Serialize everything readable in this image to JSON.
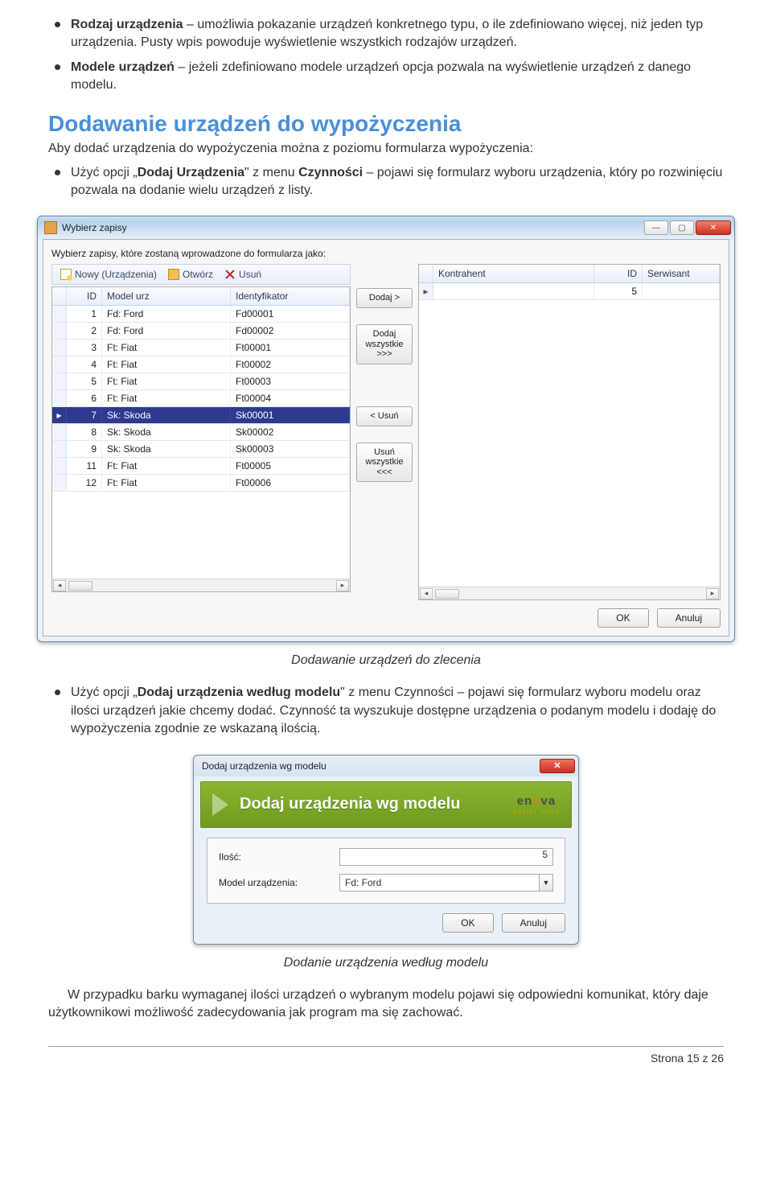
{
  "bullets_top": [
    {
      "bold": "Rodzaj urządzenia",
      "rest": " – umożliwia pokazanie urządzeń konkretnego typu, o ile zdefiniowano więcej, niż jeden typ urządzenia. Pusty wpis powoduje wyświetlenie wszystkich rodzajów urządzeń."
    },
    {
      "bold": "Modele urządzeń",
      "rest": " – jeżeli zdefiniowano modele urządzeń opcja pozwala na wyświetlenie urządzeń z danego modelu."
    }
  ],
  "section_title": "Dodawanie urządzeń do wypożyczenia",
  "section_intro": "Aby dodać urządzenia do wypożyczenia można z poziomu formularza wypożyczenia:",
  "bullet_mid": {
    "pre": "Użyć opcji „",
    "b1": "Dodaj Urządzenia",
    "mid": "\" z menu ",
    "b2": "Czynności",
    "rest": " – pojawi się formularz wyboru urządzenia, który po rozwinięciu pozwala na dodanie wielu urządzeń z listy."
  },
  "dialog1": {
    "title": "Wybierz zapisy",
    "instruction": "Wybierz zapisy, które zostaną wprowadzone do formularza jako:",
    "toolbar": {
      "new": "Nowy (Urządzenia)",
      "open": "Otwórz",
      "delete": "Usuń"
    },
    "left_headers": {
      "id": "ID",
      "model": "Model urz",
      "ident": "Identyfikator"
    },
    "left_rows": [
      {
        "id": "1",
        "model": "Fd: Ford",
        "ident": "Fd00001",
        "sel": false
      },
      {
        "id": "2",
        "model": "Fd: Ford",
        "ident": "Fd00002",
        "sel": false
      },
      {
        "id": "3",
        "model": "Ft: Fiat",
        "ident": "Ft00001",
        "sel": false
      },
      {
        "id": "4",
        "model": "Ft: Fiat",
        "ident": "Ft00002",
        "sel": false
      },
      {
        "id": "5",
        "model": "Ft: Fiat",
        "ident": "Ft00003",
        "sel": false
      },
      {
        "id": "6",
        "model": "Ft: Fiat",
        "ident": "Ft00004",
        "sel": false
      },
      {
        "id": "7",
        "model": "Sk: Skoda",
        "ident": "Sk00001",
        "sel": true
      },
      {
        "id": "8",
        "model": "Sk: Skoda",
        "ident": "Sk00002",
        "sel": false
      },
      {
        "id": "9",
        "model": "Sk: Skoda",
        "ident": "Sk00003",
        "sel": false
      },
      {
        "id": "11",
        "model": "Ft: Fiat",
        "ident": "Ft00005",
        "sel": false
      },
      {
        "id": "12",
        "model": "Ft: Fiat",
        "ident": "Ft00006",
        "sel": false
      }
    ],
    "mid_buttons": {
      "add": "Dodaj >",
      "add_all": "Dodaj wszystkie >>>",
      "remove": "< Usuń",
      "remove_all": "Usuń wszystkie <<<"
    },
    "right_headers": {
      "kontr": "Kontrahent",
      "id": "ID",
      "serw": "Serwisant"
    },
    "right_rows": [
      {
        "kontr": "",
        "id": "5",
        "serw": ""
      }
    ],
    "ok": "OK",
    "cancel": "Anuluj"
  },
  "caption1": "Dodawanie urządzeń do zlecenia",
  "bullet_mid2": {
    "pre": "Użyć opcji „",
    "b1": "Dodaj urządzenia według modelu",
    "rest": "\" z menu Czynności – pojawi się formularz wyboru modelu oraz ilości urządzeń jakie chcemy dodać. Czynność ta wyszukuje dostępne urządzenia o podanym modelu i dodaję do wypożyczenia zgodnie ze wskazaną ilością."
  },
  "dialog2": {
    "title": "Dodaj urządzenia wg modelu",
    "banner": "Dodaj urządzenia wg modelu",
    "brand": "enova",
    "brand_sub": "pakiet złoty",
    "label_qty": "Ilość:",
    "value_qty": "5",
    "label_model": "Model urządzenia:",
    "value_model": "Fd: Ford",
    "ok": "OK",
    "cancel": "Anuluj"
  },
  "caption2": "Dodanie urządzenia według modelu",
  "closing_para": "W przypadku barku wymaganej ilości urządzeń o wybranym modelu pojawi się odpowiedni komunikat, który daje użytkownikowi możliwość zadecydowania jak program ma się zachować.",
  "footer": "Strona 15 z 26"
}
